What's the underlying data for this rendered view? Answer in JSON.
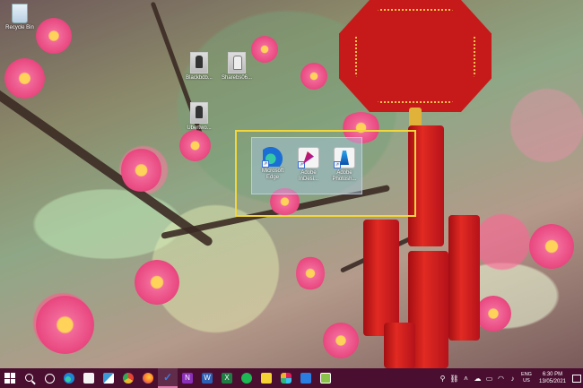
{
  "desktop": {
    "recycle_bin": {
      "label": "Recycle Bin"
    },
    "files": [
      {
        "label": "Blackbdb...",
        "icon": "photo-file-icon"
      },
      {
        "label": "Sharebs06...",
        "icon": "photo-file-icon"
      },
      {
        "label": "Ubertwo...",
        "icon": "photo-file-icon"
      }
    ],
    "selected_shortcuts": [
      {
        "label": "Microsoft Edge",
        "icon": "edge-icon"
      },
      {
        "label": "Adobe InDesi...",
        "icon": "indesign-icon"
      },
      {
        "label": "Adobe Photosh...",
        "icon": "photoshop-icon"
      }
    ],
    "selection_highlight_color": "#f3d63a"
  },
  "taskbar": {
    "background": "#4a0f30",
    "apps": [
      {
        "name": "start",
        "icon": "windows-logo-icon"
      },
      {
        "name": "search",
        "icon": "search-icon"
      },
      {
        "name": "cortana",
        "icon": "cortana-icon"
      },
      {
        "name": "edge",
        "icon": "edge-icon",
        "color": "#1f86d6"
      },
      {
        "name": "store",
        "icon": "store-icon",
        "color": "#f2f2f2"
      },
      {
        "name": "app-blue",
        "icon": "app-icon",
        "color": "#3a9bd6"
      },
      {
        "name": "chrome",
        "icon": "chrome-icon",
        "color": "#e9b830"
      },
      {
        "name": "firefox",
        "icon": "firefox-icon",
        "color": "#ff7b2b"
      },
      {
        "name": "todo",
        "icon": "checkmark-icon",
        "color": "#3c7be0"
      },
      {
        "name": "onenote",
        "icon": "onenote-icon",
        "color": "#8a2fb8"
      },
      {
        "name": "word",
        "icon": "word-icon",
        "color": "#2b5fb3"
      },
      {
        "name": "excel",
        "icon": "excel-icon",
        "color": "#1f7d44"
      },
      {
        "name": "spotify",
        "icon": "spotify-icon",
        "color": "#1db954"
      },
      {
        "name": "sticky-notes",
        "icon": "sticky-notes-icon",
        "color": "#f5d233"
      },
      {
        "name": "slack",
        "icon": "slack-icon",
        "color": "#e8a33b"
      },
      {
        "name": "photos",
        "icon": "photos-icon",
        "color": "#2a7de1"
      },
      {
        "name": "greenshot",
        "icon": "greenshot-icon",
        "color": "#8bc34a"
      }
    ],
    "tray": {
      "language_top": "ENG",
      "language_bottom": "US",
      "time": "6:30 PM",
      "date": "13/05/2021"
    }
  }
}
